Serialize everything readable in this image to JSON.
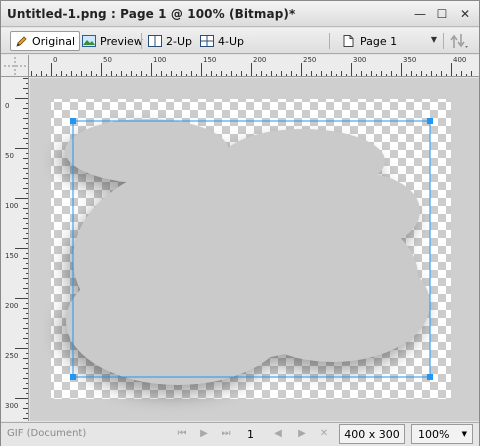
{
  "window": {
    "title": "Untitled-1.png : Page 1 @ 100% (Bitmap)*",
    "minimize_glyph": "—",
    "maximize_glyph": "☐",
    "close_glyph": "✕"
  },
  "toolbar": {
    "views": [
      {
        "label": "Original",
        "icon": "pencil-icon",
        "active": true
      },
      {
        "label": "Preview",
        "icon": "image-icon",
        "active": false
      },
      {
        "label": "2-Up",
        "icon": "two-up-icon",
        "active": false
      },
      {
        "label": "4-Up",
        "icon": "four-up-icon",
        "active": false
      }
    ],
    "page_select": {
      "value": "Page 1",
      "icon": "page-icon"
    },
    "arrow_glyph": "▼"
  },
  "rulers": {
    "horizontal_labels": [
      "0",
      "50",
      "100",
      "150",
      "200",
      "250",
      "300",
      "350",
      "400"
    ],
    "vertical_labels": [
      "0",
      "50",
      "100",
      "150",
      "200",
      "250",
      "300"
    ]
  },
  "statusbar": {
    "format": "GIF (Document)",
    "frame": "1",
    "dimensions": "400 x 300",
    "zoom": "100%",
    "zoom_arrow": "▼",
    "nav_glyphs": {
      "first": "⏮",
      "play": "▶",
      "last": "⏭",
      "prev": "◀",
      "next": "▶",
      "stop": "✕"
    }
  },
  "colors": {
    "selection": "#2196f3",
    "shape_fill": "#cacaca",
    "canvas_bg": "#cfcfcf"
  }
}
